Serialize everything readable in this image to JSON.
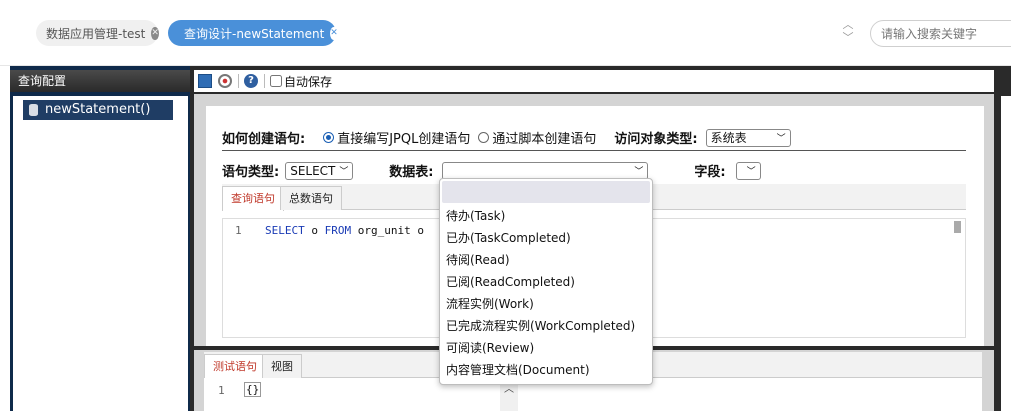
{
  "tabs": [
    {
      "label": "数据应用管理-test",
      "active": false
    },
    {
      "label": "查询设计-newStatement",
      "active": true
    }
  ],
  "search": {
    "placeholder": "请输入搜索关键字"
  },
  "left_panel": {
    "title": "查询配置",
    "tree_item": "newStatement()"
  },
  "toolbar": {
    "autosave_label": "自动保存",
    "autosave_checked": false
  },
  "form": {
    "create_label": "如何创建语句:",
    "radio_direct": "直接编写JPQL创建语句",
    "radio_script": "通过脚本创建语句",
    "access_type_label": "访问对象类型:",
    "access_type_value": "系统表",
    "statement_type_label": "语句类型:",
    "statement_type_value": "SELECT",
    "table_label": "数据表:",
    "table_value": "",
    "field_label": "字段:",
    "field_value": ""
  },
  "editor_tabs": [
    "查询语句",
    "总数语句"
  ],
  "editor": {
    "line_number": "1",
    "code_select": "SELECT",
    "code_mid": " o ",
    "code_from": "FROM",
    "code_rest": " org_unit o"
  },
  "lower_tabs": [
    "测试语句",
    "视图"
  ],
  "lower_editor": {
    "line_number": "1",
    "content": "{}"
  },
  "dropdown_options": [
    "待办(Task)",
    "已办(TaskCompleted)",
    "待阅(Read)",
    "已阅(ReadCompleted)",
    "流程实例(Work)",
    "已完成流程实例(WorkCompleted)",
    "可阅读(Review)",
    "内容管理文档(Document)"
  ],
  "colors": {
    "accent": "#4a90d9",
    "active_tab_text": "#c0392b",
    "tree_selected": "#1f3d64"
  }
}
